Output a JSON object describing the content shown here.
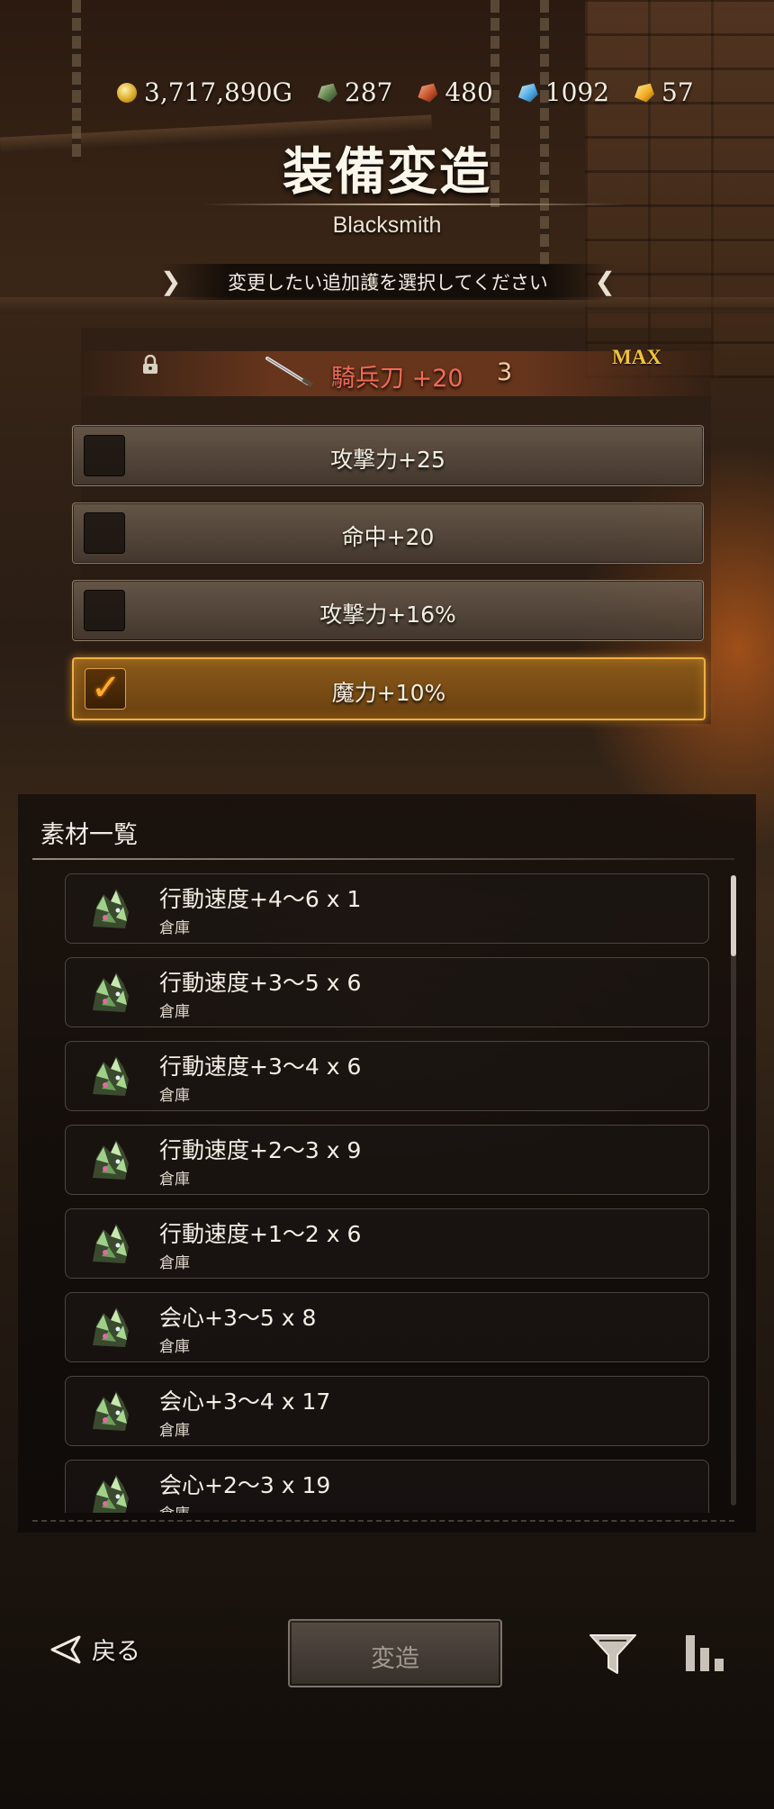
{
  "currencies": [
    {
      "icon": "gold-coin-icon",
      "value": "3,717,890G"
    },
    {
      "icon": "green-ore-icon",
      "value": "287"
    },
    {
      "icon": "red-ore-icon",
      "value": "480"
    },
    {
      "icon": "blue-ore-icon",
      "value": "1092"
    },
    {
      "icon": "gold-ore-icon",
      "value": "57"
    }
  ],
  "header": {
    "title": "装備変造",
    "subtitle": "Blacksmith",
    "instruction": "変更したい追加護を選択してください"
  },
  "item": {
    "name": "騎兵刀 +20",
    "count": "3",
    "max_label": "MAX"
  },
  "options": [
    {
      "label": "攻撃力+25",
      "selected": false
    },
    {
      "label": "命中+20",
      "selected": false
    },
    {
      "label": "攻撃力+16%",
      "selected": false
    },
    {
      "label": "魔力+10%",
      "selected": true
    }
  ],
  "materials": {
    "title": "素材一覧",
    "items": [
      {
        "name": "行動速度+4～6 x 1",
        "location": "倉庫"
      },
      {
        "name": "行動速度+3～5 x 6",
        "location": "倉庫"
      },
      {
        "name": "行動速度+3～4 x 6",
        "location": "倉庫"
      },
      {
        "name": "行動速度+2～3 x 9",
        "location": "倉庫"
      },
      {
        "name": "行動速度+1～2 x 6",
        "location": "倉庫"
      },
      {
        "name": "会心+3～5 x 8",
        "location": "倉庫"
      },
      {
        "name": "会心+3～4 x 17",
        "location": "倉庫"
      },
      {
        "name": "会心+2～3 x 19",
        "location": "倉庫"
      }
    ]
  },
  "footer": {
    "back_label": "戻る",
    "modify_label": "変造"
  },
  "colors": {
    "item_name": "#f06a58",
    "max_label": "#f0c43a",
    "selected_border": "#f0b040",
    "check": "#ffae2a"
  }
}
